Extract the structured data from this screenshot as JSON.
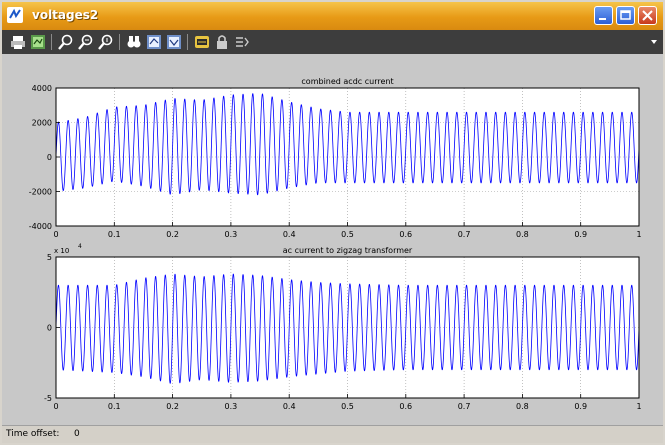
{
  "window": {
    "title": "voltages2"
  },
  "toolbar": {
    "buttons": [
      {
        "name": "print-icon",
        "color": "#dddddd"
      },
      {
        "name": "parameters-icon",
        "color": "#7fbf6a"
      },
      {
        "name": "zoom-icon",
        "color": "#ffffff"
      },
      {
        "name": "zoom-x-icon",
        "color": "#ffffff"
      },
      {
        "name": "zoom-y-icon",
        "color": "#ffffff"
      },
      {
        "name": "autoscale-icon",
        "color": "#ffffff"
      },
      {
        "name": "save-axes-icon",
        "color": "#9ec3ff"
      },
      {
        "name": "restore-axes-icon",
        "color": "#9ec3ff"
      },
      {
        "name": "floating-scope-icon",
        "color": "#f0d050"
      },
      {
        "name": "lock-axes-icon",
        "color": "#cccccc"
      },
      {
        "name": "signal-selection-icon",
        "color": "#cccccc"
      }
    ]
  },
  "status": {
    "label": "Time offset:",
    "value": "0"
  },
  "chart_data": [
    {
      "type": "line",
      "title": "combined acdc current",
      "xlim": [
        0,
        1
      ],
      "ylim": [
        -4000,
        4000
      ],
      "yticks": [
        -4000,
        -2000,
        0,
        2000,
        4000
      ],
      "xticks": [
        0,
        0.1,
        0.2,
        0.3,
        0.4,
        0.5,
        0.6,
        0.7,
        0.8,
        0.9,
        1
      ],
      "grid": true,
      "line_color": "#0000ff",
      "frequency_hz": 60,
      "envelope_t": [
        0,
        0.05,
        0.1,
        0.15,
        0.2,
        0.25,
        0.3,
        0.35,
        0.4,
        0.45,
        0.5,
        0.6,
        0.7,
        0.8,
        0.9,
        1.0
      ],
      "envelope_max": [
        2000,
        2300,
        2900,
        3000,
        3400,
        3300,
        3600,
        3700,
        3200,
        2800,
        2600,
        2600,
        2600,
        2600,
        2600,
        2600
      ],
      "envelope_min": [
        -2000,
        -1800,
        -1400,
        -1700,
        -2200,
        -1900,
        -2100,
        -2200,
        -1800,
        -1500,
        -1500,
        -1500,
        -1500,
        -1500,
        -1500,
        -1500
      ]
    },
    {
      "type": "line",
      "title": "ac current to zigzag transformer",
      "exponent_label": "x 10",
      "exponent_power": "4",
      "xlim": [
        0,
        1
      ],
      "ylim": [
        -5,
        5
      ],
      "yticks": [
        -5,
        0,
        5
      ],
      "xticks": [
        0,
        0.1,
        0.2,
        0.3,
        0.4,
        0.5,
        0.6,
        0.7,
        0.8,
        0.9,
        1
      ],
      "grid": true,
      "line_color": "#0000ff",
      "frequency_hz": 60,
      "envelope_t": [
        0,
        0.05,
        0.1,
        0.15,
        0.2,
        0.25,
        0.3,
        0.35,
        0.4,
        0.45,
        0.5,
        0.6,
        0.7,
        0.8,
        0.9,
        1.0
      ],
      "envelope_max": [
        3.0,
        3.0,
        3.0,
        3.5,
        3.8,
        3.6,
        3.8,
        3.7,
        3.4,
        3.2,
        3.1,
        3.0,
        3.0,
        3.0,
        3.0,
        3.0
      ],
      "envelope_min": [
        -3.0,
        -3.1,
        -3.2,
        -3.5,
        -4.0,
        -3.7,
        -3.9,
        -3.8,
        -3.5,
        -3.3,
        -3.1,
        -3.0,
        -3.0,
        -3.0,
        -3.0,
        -3.0
      ]
    }
  ]
}
